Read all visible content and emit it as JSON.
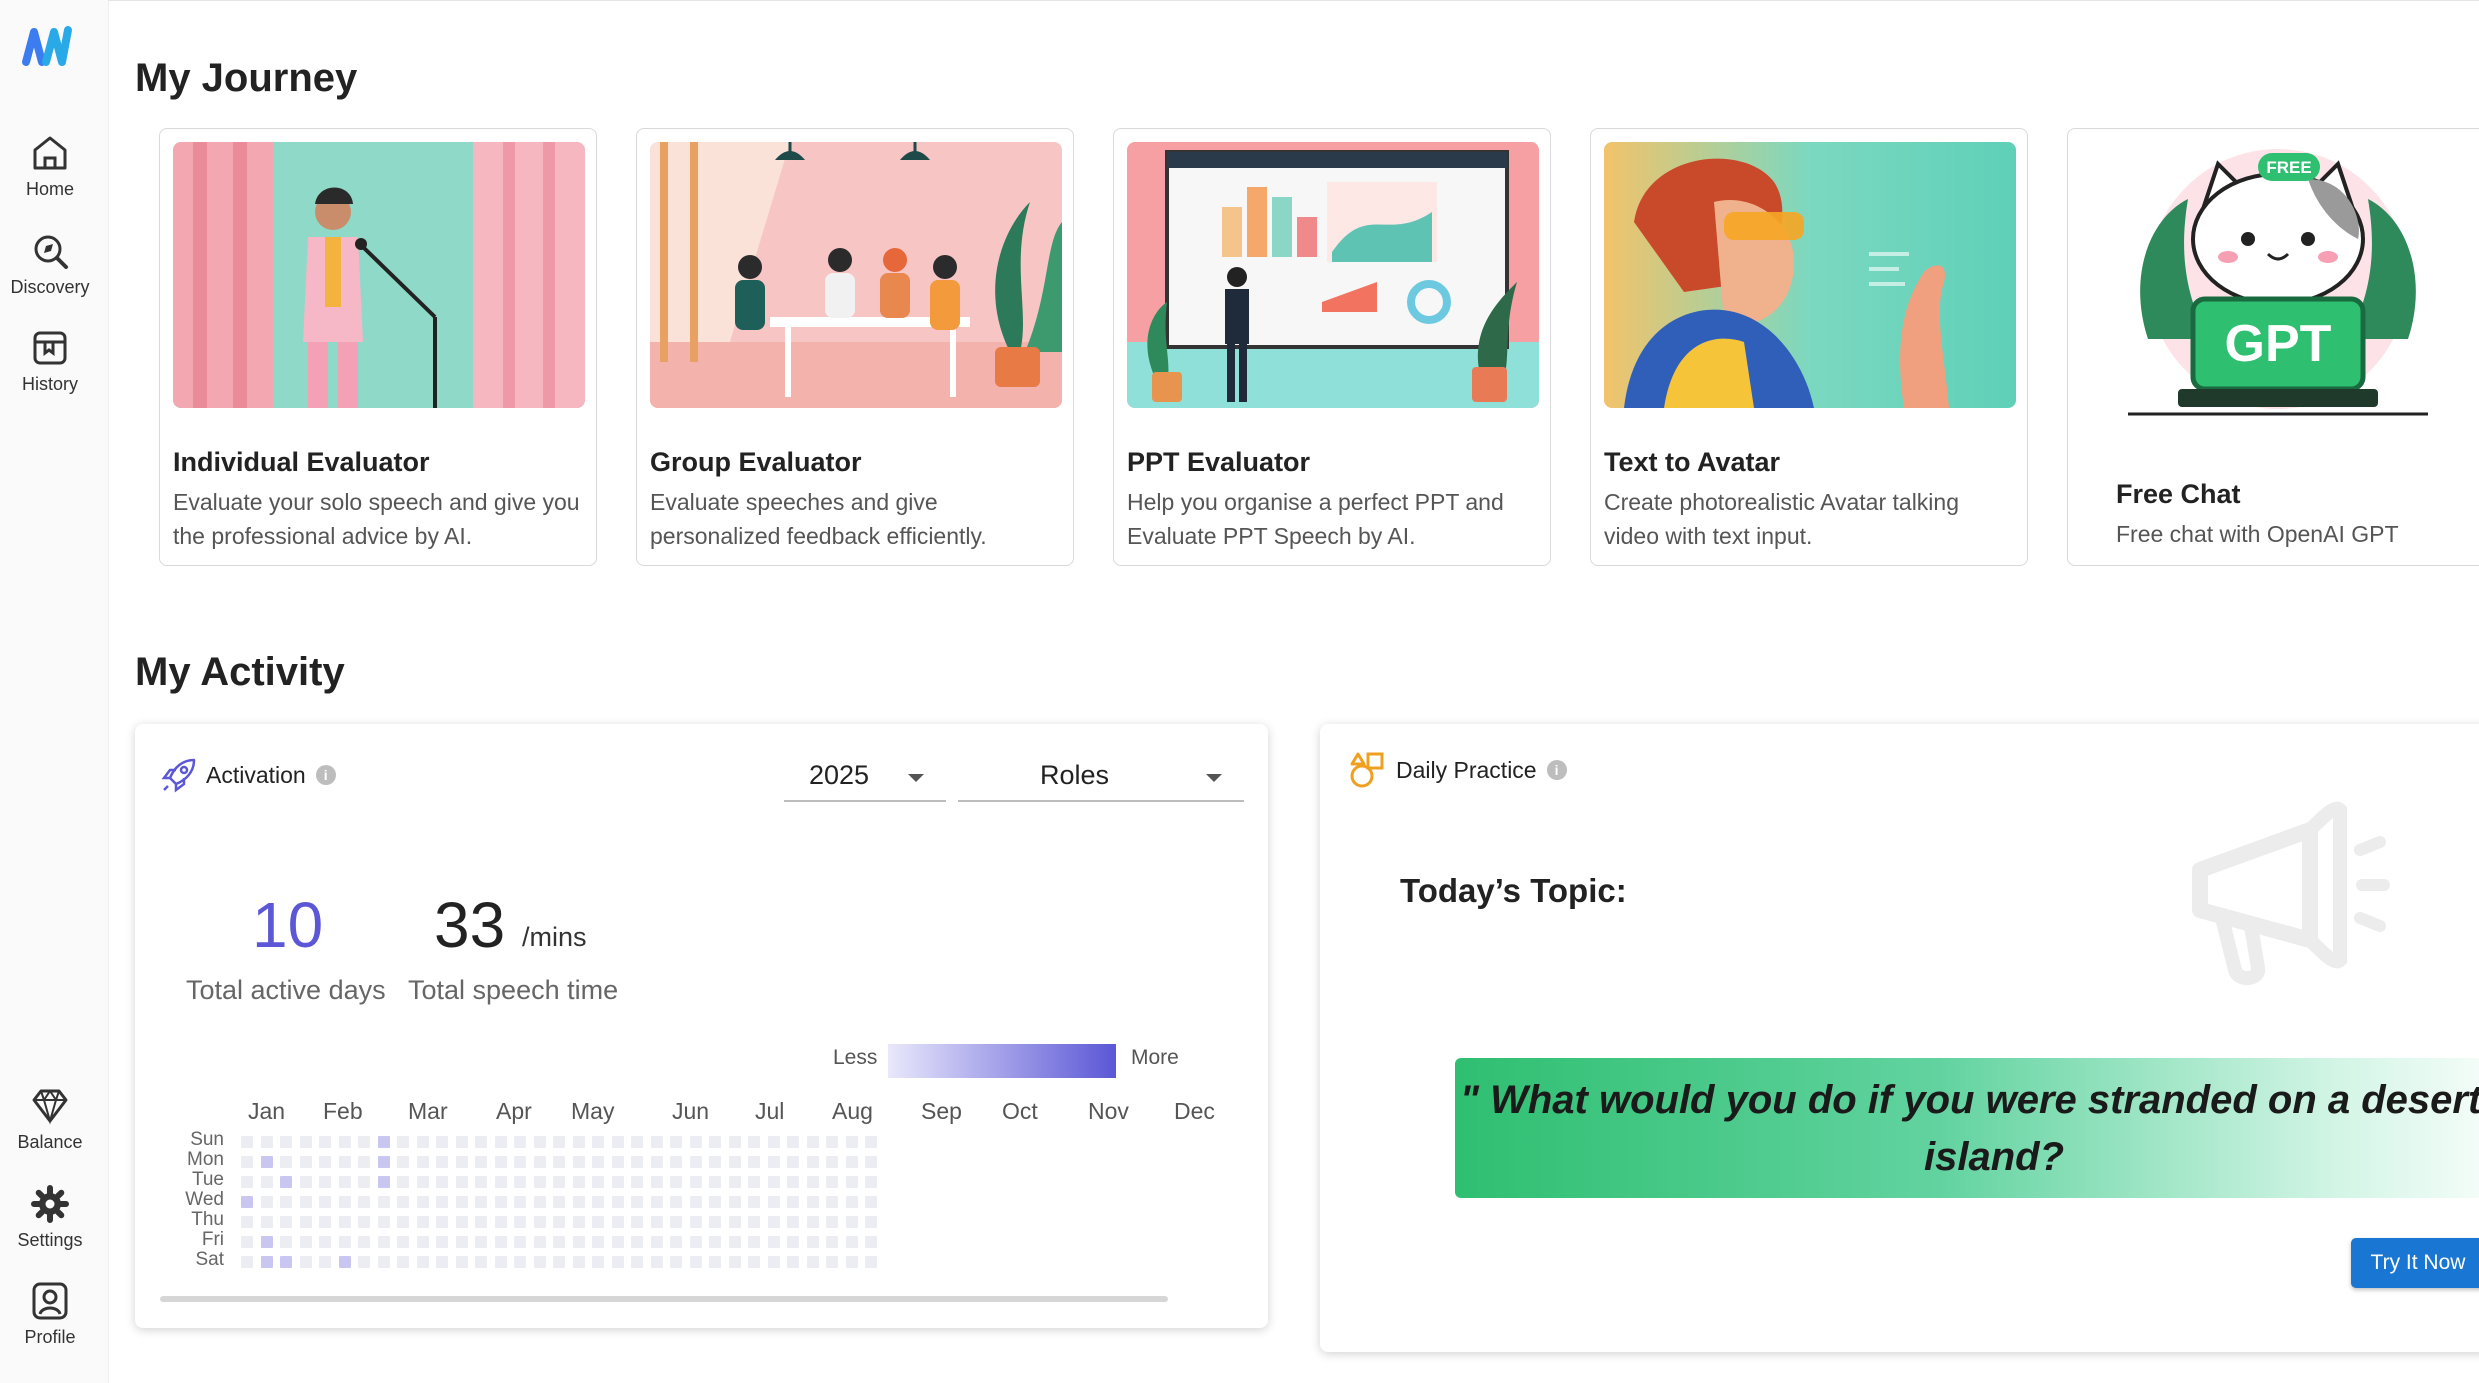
{
  "sidebar": {
    "logo": "app-logo",
    "items": [
      {
        "label": "Home",
        "icon": "home-icon"
      },
      {
        "label": "Discovery",
        "icon": "discovery-icon"
      },
      {
        "label": "History",
        "icon": "history-icon"
      }
    ],
    "bottom_items": [
      {
        "label": "Balance",
        "icon": "diamond-icon"
      },
      {
        "label": "Settings",
        "icon": "gear-icon"
      },
      {
        "label": "Profile",
        "icon": "profile-icon"
      }
    ]
  },
  "journey": {
    "title": "My Journey",
    "cards": [
      {
        "title": "Individual Evaluator",
        "desc": "Evaluate your solo speech and give you the professional advice by AI."
      },
      {
        "title": "Group Evaluator",
        "desc": "Evaluate speeches and give personalized feedback efficiently."
      },
      {
        "title": "PPT Evaluator",
        "desc": "Help you organise a perfect PPT and Evaluate PPT Speech by AI."
      },
      {
        "title": "Text to Avatar",
        "desc": "Create photorealistic Avatar talking video with text input."
      },
      {
        "title": "Free Chat",
        "desc": "Free chat with OpenAI GPT",
        "badge": "FREE",
        "art_text": "GPT"
      }
    ]
  },
  "activity": {
    "title": "My Activity",
    "activation": {
      "label": "Activation",
      "year": "2025",
      "roles": "Roles",
      "active_days": "10",
      "active_days_label": "Total active days",
      "speech_time": "33",
      "speech_time_unit": "/mins",
      "speech_time_label": "Total speech time",
      "legend_less": "Less",
      "legend_more": "More",
      "months": [
        "Jan",
        "Feb",
        "Mar",
        "Apr",
        "May",
        "Jun",
        "Jul",
        "Aug",
        "Sep",
        "Oct",
        "Nov",
        "Dec"
      ],
      "weekdays": [
        "Sun",
        "Mon",
        "Tue",
        "Wed",
        "Thu",
        "Fri",
        "Sat"
      ],
      "active_cells": [
        {
          "week": 1,
          "day": 1
        },
        {
          "week": 1,
          "day": 5
        },
        {
          "week": 1,
          "day": 6
        },
        {
          "week": 2,
          "day": 2
        },
        {
          "week": 2,
          "day": 6
        },
        {
          "week": 5,
          "day": 6
        },
        {
          "week": 7,
          "day": 0
        },
        {
          "week": 7,
          "day": 1
        },
        {
          "week": 7,
          "day": 2
        },
        {
          "week": 0,
          "day": 3
        }
      ],
      "colors": {
        "accent": "#5b57d6",
        "cell_empty": "#ececf3",
        "cell_active": "#c9c7f2"
      }
    },
    "daily": {
      "label": "Daily Practice",
      "topic_label": "Today’s Topic:",
      "topic": "\" What would you do if you were stranded on a deserted island?",
      "button": "Try It Now"
    }
  }
}
